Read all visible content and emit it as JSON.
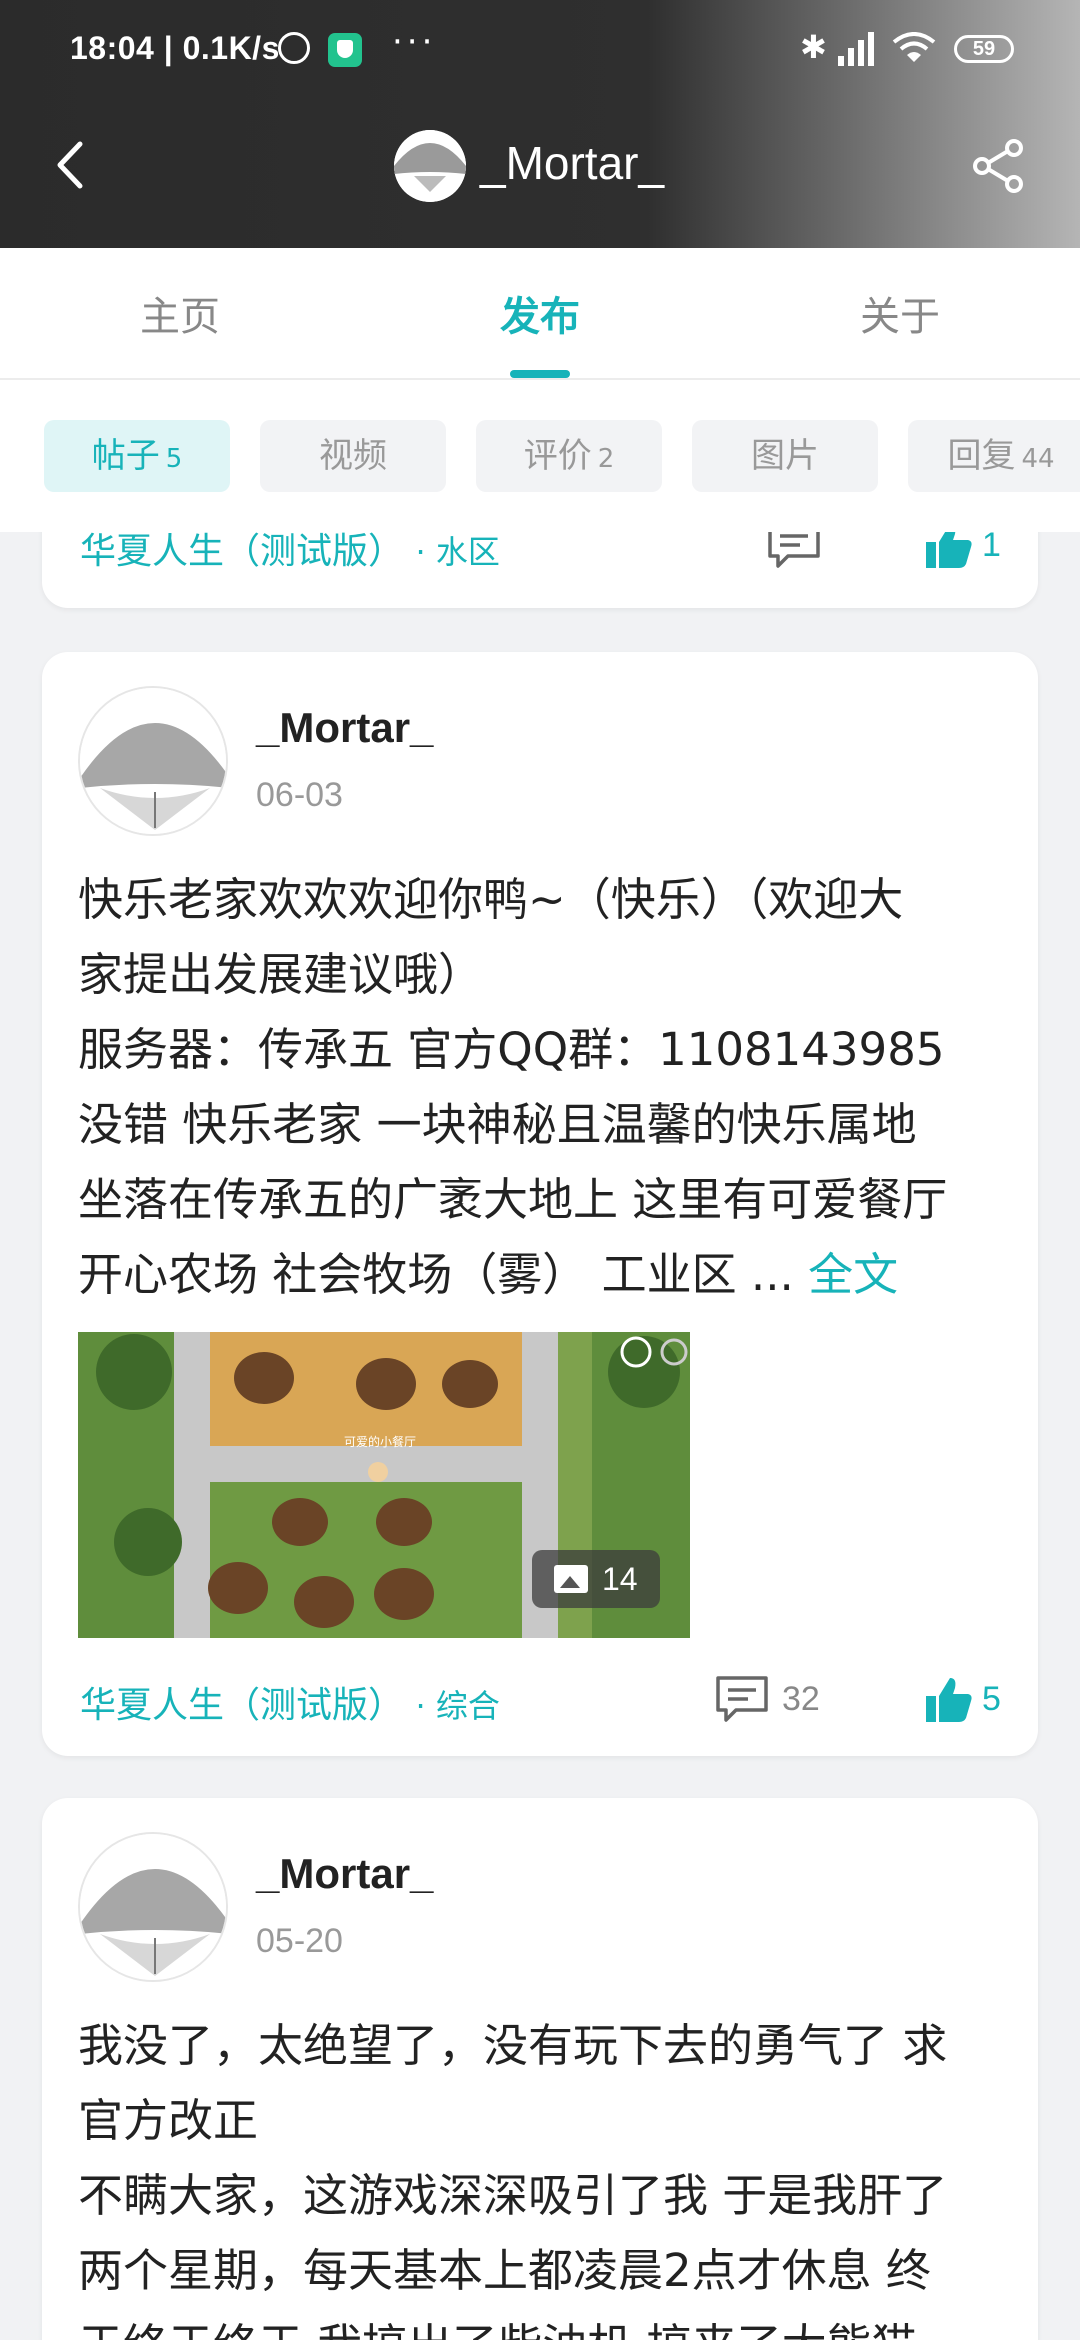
{
  "status_bar": {
    "time": "18:04 | 0.1K/s",
    "more": "···",
    "bluetooth": "✱",
    "battery": "59"
  },
  "navbar": {
    "title": "_Mortar_",
    "icons": [
      "back-icon",
      "share-icon"
    ]
  },
  "tabs": [
    {
      "label": "主页"
    },
    {
      "label": "发布",
      "active": true
    },
    {
      "label": "关于"
    }
  ],
  "chips": [
    {
      "label": "帖子",
      "count": "5",
      "active": true
    },
    {
      "label": "视频",
      "count": ""
    },
    {
      "label": "评价",
      "count": "2"
    },
    {
      "label": "图片",
      "count": ""
    },
    {
      "label": "回复",
      "count": "44"
    }
  ],
  "accent_color": "#17b3b9",
  "posts": [
    {
      "forum": "华夏人生（测试版）",
      "section": "· 水区",
      "comments": "",
      "likes": "1"
    },
    {
      "author": "_Mortar_",
      "date": "06-03",
      "content_lines": [
        "快乐老家欢欢欢迎你鸭~（快乐）（欢迎大",
        "家提出发展建议哦）",
        "服务器：传承五 官方QQ群：1108143985",
        "没错 快乐老家 一块神秘且温馨的快乐属地",
        "坐落在传承五的广袤大地上 这里有可爱餐厅",
        "开心农场 社会牧场（雾） 工业区 ..."
      ],
      "more_link": "全文",
      "image_count": "14",
      "image_caption": "可爱的小餐厅",
      "forum": "华夏人生（测试版）",
      "section": "· 综合",
      "comments": "32",
      "likes": "5"
    },
    {
      "author": "_Mortar_",
      "date": "05-20",
      "content_lines": [
        "我没了，太绝望了，没有玩下去的勇气了 求",
        "官方改正",
        "不瞒大家，这游戏深深吸引了我 于是我肝了",
        "两个星期，每天基本上都凌晨2点才休息 终",
        "于终于终于 我搞出了柴油机 搞来了大熊猫"
      ]
    }
  ]
}
